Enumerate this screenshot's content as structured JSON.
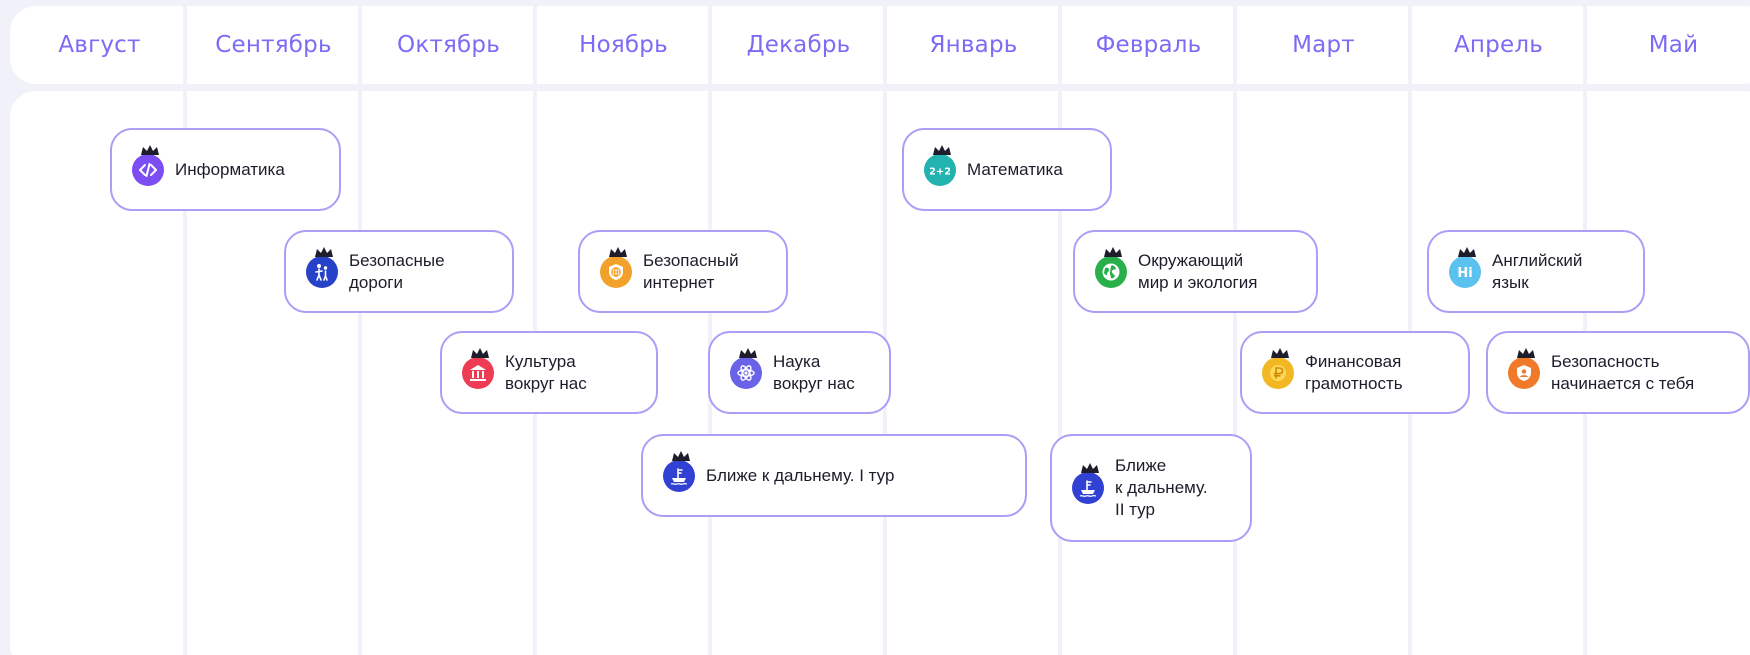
{
  "months": [
    "Август",
    "Сентябрь",
    "Октябрь",
    "Ноябрь",
    "Декабрь",
    "Январь",
    "Февраль",
    "Март",
    "Апрель",
    "Май"
  ],
  "events": [
    {
      "label": "Информатика",
      "icon": "code-icon",
      "color": "#7b4df2"
    },
    {
      "label": "Математика",
      "icon": "math-icon",
      "color": "#22b3b0"
    },
    {
      "label": "Безопасные\nдороги",
      "icon": "pedestrians-icon",
      "color": "#2642c9"
    },
    {
      "label": "Безопасный\nинтернет",
      "icon": "globe-shield-icon",
      "color": "#f2a12b"
    },
    {
      "label": "Окружающий\nмир и экология",
      "icon": "earth-icon",
      "color": "#29b04a"
    },
    {
      "label": "Английский\nязык",
      "icon": "hi-icon",
      "color": "#5bc2f0"
    },
    {
      "label": "Культура\nвокруг нас",
      "icon": "museum-icon",
      "color": "#ee3c55"
    },
    {
      "label": "Наука\nвокруг нас",
      "icon": "atom-icon",
      "color": "#6a63e8"
    },
    {
      "label": "Финансовая\nграмотность",
      "icon": "ruble-coin-icon",
      "color": "#f2b824"
    },
    {
      "label": "Безопасность\nначинается с тебя",
      "icon": "user-shield-icon",
      "color": "#f07a2a"
    },
    {
      "label": "Ближе к дальнему. I тур",
      "icon": "ship-icon",
      "color": "#3141d4"
    },
    {
      "label": "Ближе\nк дальнему.\nII тур",
      "icon": "ship-icon",
      "color": "#3141d4"
    }
  ],
  "colors": {
    "accent": "#7b6cf6",
    "card_border": "#a99ff7",
    "background": "#f1f1fa"
  }
}
